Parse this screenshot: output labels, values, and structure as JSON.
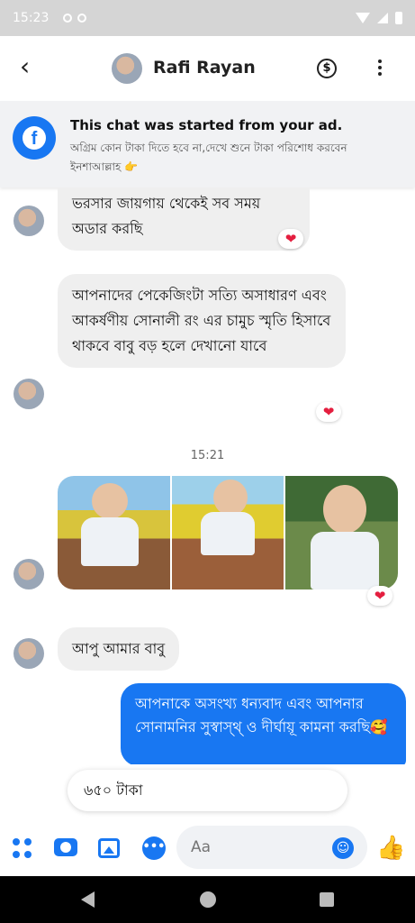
{
  "status": {
    "time": "15:23"
  },
  "header": {
    "back_icon": "chevron-left-icon",
    "contact_name": "Rafi Rayan",
    "payment_icon": "dollar-icon",
    "more_icon": "more-vertical-icon"
  },
  "ad_banner": {
    "title": "This chat was started from your ad.",
    "subtitle": "অগ্রিম কোন টাকা দিতে হবে না,দেখে শুনে টাকা পরিশোধ করবেন ইনশাআল্লাহ 👉"
  },
  "messages": {
    "m1": "ভরসার জায়গায় থেকেই সব সময় অডার করছি",
    "m2": "আপনাদের পেকেজিংটা সত্যি অসাধারণ এবং আকর্ষণীয়  সোনালী রং এর চামুচ স্মৃতি হিসাবে থাকবে বাবু বড় হলে দেখানো যাবে",
    "timestamp": "15:21",
    "m3": "আপু আমার বাবু",
    "m4": "আপনাকে অসংখ্য ধন্যবাদ এবং আপনার সোনামনির সুস্বাস্থ্ ও দীর্ঘায়ূ কামনা করছি🥰",
    "reaction": "❤"
  },
  "quick_reply": {
    "text": "৬৫০ টাকা"
  },
  "composer": {
    "placeholder": "Aa"
  },
  "colors": {
    "accent": "#1877f2",
    "bubble_in": "#efefef",
    "heart": "#e41e3f"
  }
}
